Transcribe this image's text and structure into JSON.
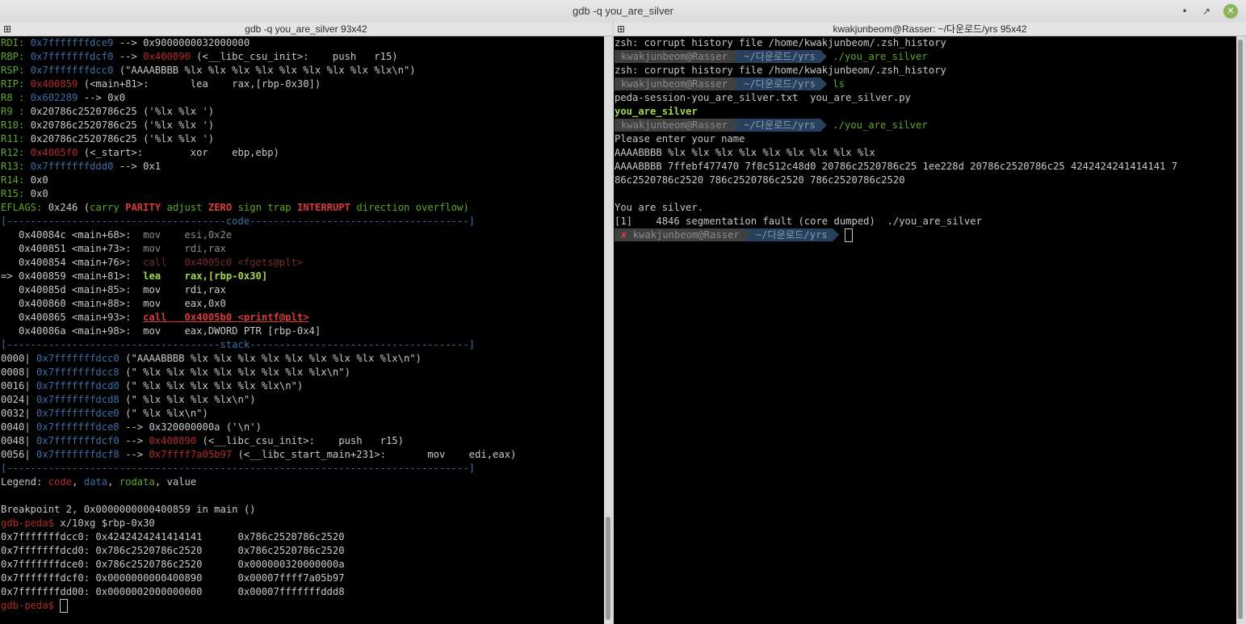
{
  "window": {
    "title": "gdb -q you_are_silver",
    "minimize": "•",
    "maximize": "↗",
    "close": "✕"
  },
  "left_pane": {
    "title": "gdb -q you_are_silver 93x42",
    "registers": {
      "rdi": [
        "RDI: ",
        "0x7fffffffdce9",
        " --> 0x9000000032000000"
      ],
      "rbp": [
        "RBP: ",
        "0x7fffffffdcf0",
        " --> ",
        "0x400890",
        " (<__libc_csu_init>:    push   r15)"
      ],
      "rsp": [
        "RSP: ",
        "0x7fffffffdcc0",
        " (\"AAAABBBB %lx %lx %lx %lx %lx %lx %lx %lx %lx\\n\")"
      ],
      "rip": [
        "RIP: ",
        "0x400859",
        " (<main+81>:       lea    rax,[rbp-0x30])"
      ],
      "r8": [
        "R8 : ",
        "0x602289",
        " --> 0x0"
      ],
      "r9": [
        "R9 : ",
        "0x20786c2520786c25 ('%lx %lx ')"
      ],
      "r10": [
        "R10: ",
        "0x20786c2520786c25 ('%lx %lx ')"
      ],
      "r11": [
        "R11: ",
        "0x20786c2520786c25 ('%lx %lx ')"
      ],
      "r12": [
        "R12: ",
        "0x4005f0",
        " (<_start>:        xor    ebp,ebp)"
      ],
      "r13": [
        "R13: ",
        "0x7fffffffddd0",
        " --> 0x1"
      ],
      "r14": [
        "R14: ",
        "0x0"
      ],
      "r15": [
        "R15: ",
        "0x0"
      ],
      "eflags": [
        "EFLAGS: ",
        "0x246",
        " (",
        "carry",
        "PARITY",
        "adjust",
        "ZERO",
        "sign",
        "trap",
        "INTERRUPT",
        "direction",
        "overflow",
        ")"
      ]
    },
    "code_sep": [
      "[-------------------------------------",
      "code",
      "-------------------------------------]"
    ],
    "code": [
      [
        "   0x40084c <main+68>:  ",
        "mov    esi,0x2e"
      ],
      [
        "   0x400851 <main+73>:  ",
        "mov    rdi,rax"
      ],
      [
        "   0x400854 <main+76>:  ",
        "call   0x4005c0 <fgets@plt>"
      ],
      [
        "=> 0x400859 <main+81>:  ",
        "lea    ",
        "rax,[rbp-0x30]"
      ],
      [
        "   0x40085d <main+85>:  ",
        "mov    rdi,rax"
      ],
      [
        "   0x400860 <main+88>:  ",
        "mov    eax,0x0"
      ],
      [
        "   0x400865 <main+93>:  ",
        "call   0x4005b0 <printf@plt>"
      ],
      [
        "   0x40086a <main+98>:  ",
        "mov    eax,DWORD PTR [rbp-0x4]"
      ]
    ],
    "stack_sep": [
      "[------------------------------------",
      "stack",
      "-------------------------------------]"
    ],
    "stack": [
      [
        "0000| ",
        "0x7fffffffdcc0",
        " (\"AAAABBBB %lx %lx %lx %lx %lx %lx %lx %lx %lx\\n\")"
      ],
      [
        "0008| ",
        "0x7fffffffdcc8",
        " (\" %lx %lx %lx %lx %lx %lx %lx %lx\\n\")"
      ],
      [
        "0016| ",
        "0x7fffffffdcd0",
        " (\" %lx %lx %lx %lx %lx %lx\\n\")"
      ],
      [
        "0024| ",
        "0x7fffffffdcd8",
        " (\" %lx %lx %lx %lx\\n\")"
      ],
      [
        "0032| ",
        "0x7fffffffdce0",
        " (\" %lx %lx\\n\")"
      ],
      [
        "0040| ",
        "0x7fffffffdce8",
        " --> 0x320000000a ('\\n')"
      ],
      [
        "0048| ",
        "0x7fffffffdcf0",
        " --> ",
        "0x400890",
        " (<__libc_csu_init>:    push   r15)"
      ],
      [
        "0056| ",
        "0x7fffffffdcf8",
        " --> ",
        "0x7ffff7a05b97",
        " (<__libc_start_main+231>:       mov    edi,eax)"
      ]
    ],
    "end_sep": "[------------------------------------------------------------------------------]",
    "legend": [
      "Legend: ",
      "code",
      ", ",
      "data",
      ", ",
      "rodata",
      ", value"
    ],
    "breakpoint": "Breakpoint 2, 0x0000000000400859 in main ()",
    "prompt": "gdb-peda$ ",
    "command": "x/10xg $rbp-0x30",
    "dump": [
      "0x7fffffffdcc0: 0x4242424241414141      0x786c2520786c2520",
      "0x7fffffffdcd0: 0x786c2520786c2520      0x786c2520786c2520",
      "0x7fffffffdce0: 0x786c2520786c2520      0x000000320000000a",
      "0x7fffffffdcf0: 0x0000000000400890      0x00007ffff7a05b97",
      "0x7fffffffdd00: 0x0000002000000000      0x00007fffffffddd8"
    ]
  },
  "right_pane": {
    "title": "kwakjunbeom@Rasser: ~/다운로드/yrs 95x42",
    "lines": {
      "l1": "zsh: corrupt history file /home/kwakjunbeom/.zsh_history",
      "l3": "zsh: corrupt history file /home/kwakjunbeom/.zsh_history",
      "l5": "peda-session-you_are_silver.txt  you_are_silver.py",
      "l6": "you_are_silver",
      "l8": "Please enter your name",
      "l9": "AAAABBBB %lx %lx %lx %lx %lx %lx %lx %lx %lx",
      "l10": "AAAABBBB 7ffebf477470 7f8c512c48d0 20786c2520786c25 1ee228d 20786c2520786c25 4242424241414141 7",
      "l11": "86c2520786c2520 786c2520786c2520 786c2520786c2520",
      "l13": "You are silver.",
      "l14": "[1]    4846 segmentation fault (core dumped)  ./you_are_silver"
    },
    "prompt_user": "kwakjunbeom@Rasser",
    "prompt_path": "~/다운로드/yrs",
    "prompt_err": "✘",
    "commands": [
      "./you_are_silver",
      "ls",
      "./you_are_silver"
    ]
  }
}
